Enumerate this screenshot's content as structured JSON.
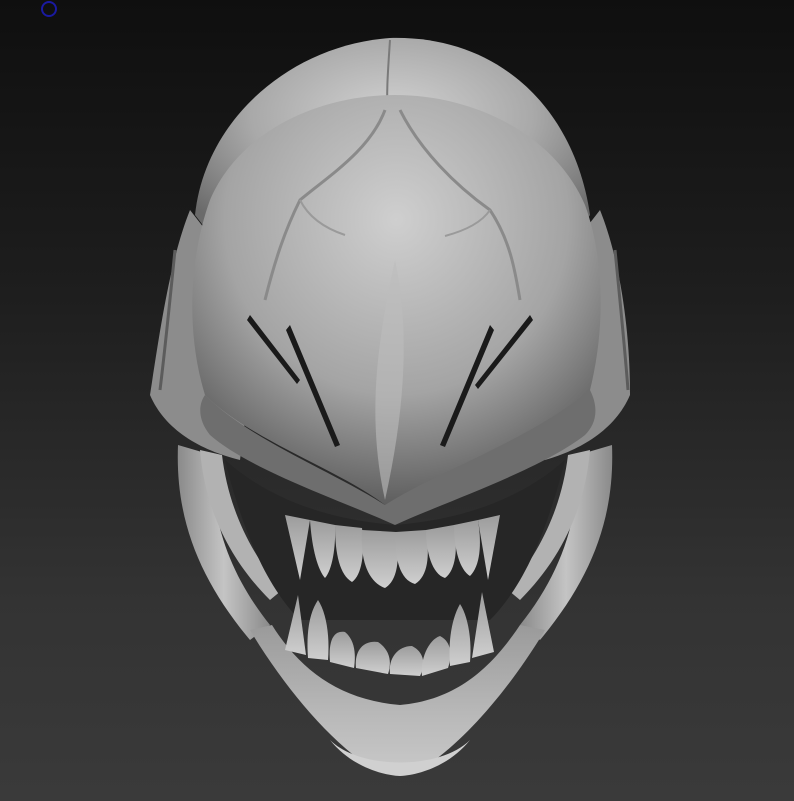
{
  "scene": {
    "subject": "alien-skull-sculpt",
    "background_top": "#0f0f0f",
    "background_bottom": "#3a3a3a",
    "material_light": "#c9c9c9",
    "material_mid": "#8f8f8f",
    "material_dark": "#3e3e3e",
    "cursor_color": "#1a1aa0"
  }
}
